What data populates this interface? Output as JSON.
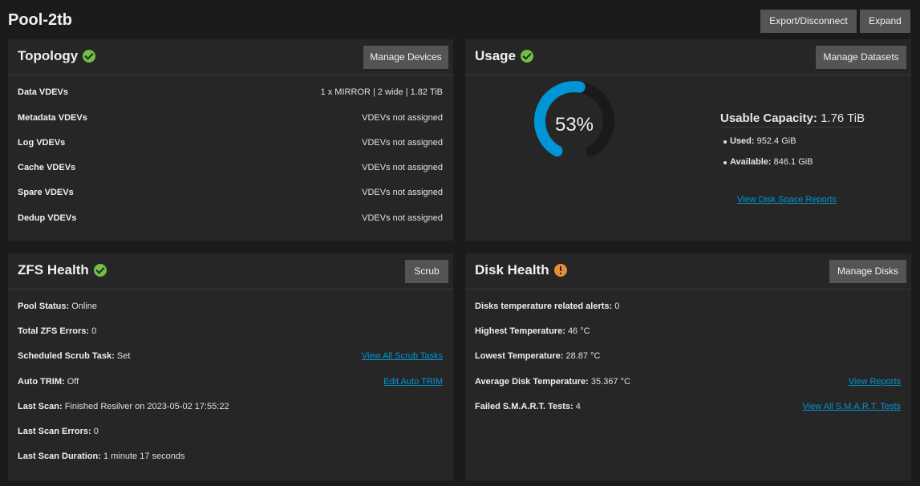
{
  "header": {
    "title": "Pool-2tb",
    "export_label": "Export/Disconnect",
    "expand_label": "Expand"
  },
  "topology": {
    "title": "Topology",
    "button": "Manage Devices",
    "rows": [
      {
        "label": "Data VDEVs",
        "value": "1 x MIRROR | 2 wide | 1.82 TiB"
      },
      {
        "label": "Metadata VDEVs",
        "value": "VDEVs not assigned"
      },
      {
        "label": "Log VDEVs",
        "value": "VDEVs not assigned"
      },
      {
        "label": "Cache VDEVs",
        "value": "VDEVs not assigned"
      },
      {
        "label": "Spare VDEVs",
        "value": "VDEVs not assigned"
      },
      {
        "label": "Dedup VDEVs",
        "value": "VDEVs not assigned"
      }
    ]
  },
  "usage": {
    "title": "Usage",
    "button": "Manage Datasets",
    "percent_text": "53%",
    "percent": 53,
    "capacity_label": "Usable Capacity:",
    "capacity_value": "1.76 TiB",
    "used_label": "Used:",
    "used_value": "952.4 GiB",
    "available_label": "Available:",
    "available_value": "846.1 GiB",
    "link": "View Disk Space Reports"
  },
  "zfs_health": {
    "title": "ZFS Health",
    "button": "Scrub",
    "rows": [
      {
        "label": "Pool Status:",
        "value": "Online",
        "link": ""
      },
      {
        "label": "Total ZFS Errors:",
        "value": "0",
        "link": ""
      },
      {
        "label": "Scheduled Scrub Task:",
        "value": "Set",
        "link": "View All Scrub Tasks"
      },
      {
        "label": "Auto TRIM:",
        "value": "Off",
        "link": "Edit Auto TRIM"
      },
      {
        "label": "Last Scan:",
        "value": "Finished Resilver on 2023-05-02 17:55:22",
        "link": ""
      },
      {
        "label": "Last Scan Errors:",
        "value": "0",
        "link": ""
      },
      {
        "label": "Last Scan Duration:",
        "value": "1 minute 17 seconds",
        "link": ""
      }
    ]
  },
  "disk_health": {
    "title": "Disk Health",
    "button": "Manage Disks",
    "rows": [
      {
        "label": "Disks temperature related alerts:",
        "value": "0",
        "link": ""
      },
      {
        "label": "Highest Temperature:",
        "value": "46 °C",
        "link": ""
      },
      {
        "label": "Lowest Temperature:",
        "value": "28.87 °C",
        "link": ""
      },
      {
        "label": "Average Disk Temperature:",
        "value": "35.367 °C",
        "link": "View Reports"
      },
      {
        "label": "Failed S.M.A.R.T. Tests:",
        "value": "4",
        "link": "View All S.M.A.R.T. Tests"
      }
    ]
  },
  "colors": {
    "ok": "#71bf44",
    "warn": "#e68d36",
    "gauge_fill": "#0095d5",
    "gauge_track": "#1a1a1a",
    "link": "#0095d5"
  },
  "icons": {
    "ok": "check-circle-icon",
    "warn": "alert-circle-icon"
  }
}
